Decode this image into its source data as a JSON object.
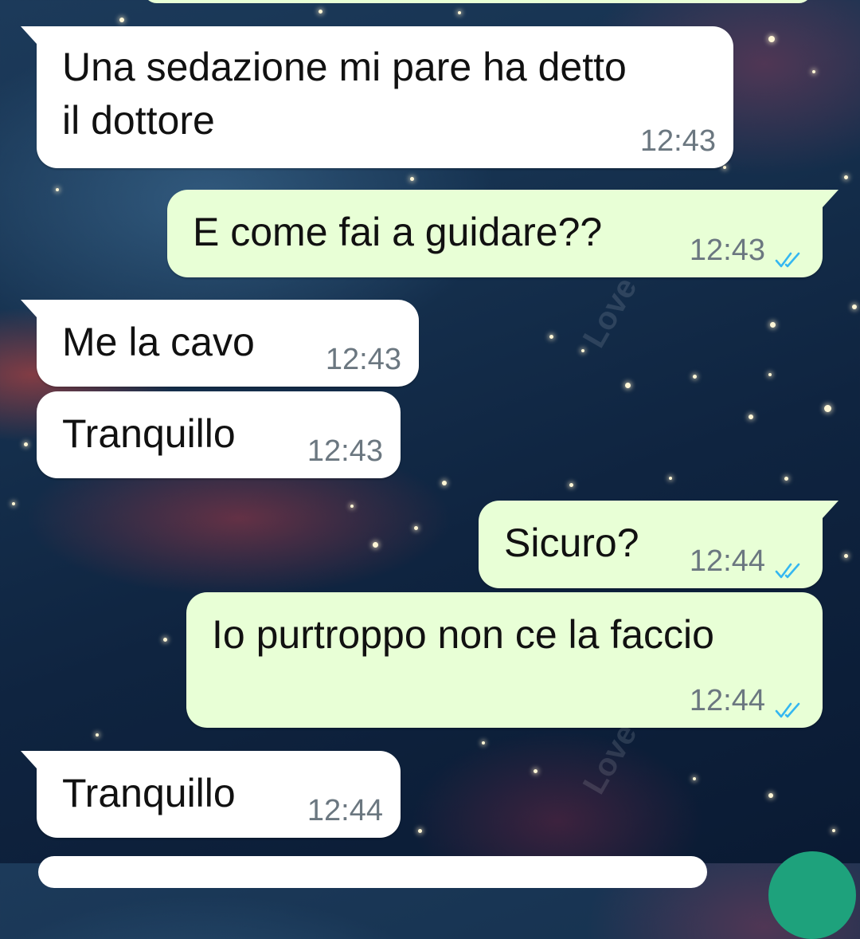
{
  "messages": [
    {
      "direction": "incoming",
      "lines": [
        "Una sedazione mi pare ha detto",
        "il dottore"
      ],
      "time": "12:43"
    },
    {
      "direction": "outgoing",
      "lines": [
        "E come fai a guidare??"
      ],
      "time": "12:43",
      "read": true
    },
    {
      "direction": "incoming",
      "lines": [
        "Me la cavo"
      ],
      "time": "12:43"
    },
    {
      "direction": "incoming",
      "lines": [
        "Tranquillo"
      ],
      "time": "12:43"
    },
    {
      "direction": "outgoing",
      "lines": [
        "Sicuro?"
      ],
      "time": "12:44",
      "read": true
    },
    {
      "direction": "outgoing",
      "lines": [
        "Io purtroppo non ce la faccio"
      ],
      "time": "12:44",
      "read": true
    },
    {
      "direction": "incoming",
      "lines": [
        "Tranquillo"
      ],
      "time": "12:44"
    }
  ],
  "colors": {
    "incoming_bubble": "#ffffff",
    "outgoing_bubble": "#e8ffd6",
    "read_ticks": "#34b7f1",
    "timestamp": "#6b7780",
    "fab": "#1ea27c"
  },
  "icons": {
    "read_receipt": "double-check-icon"
  }
}
